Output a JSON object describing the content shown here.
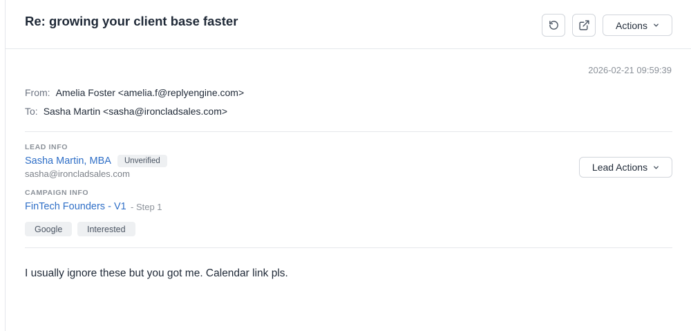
{
  "header": {
    "subject": "Re: growing your client base faster",
    "actions_label": "Actions"
  },
  "message": {
    "timestamp": "2026-02-21 09:59:39",
    "from_label": "From:",
    "from_value": "Amelia Foster <amelia.f@replyengine.com>",
    "to_label": "To:",
    "to_value": "Sasha Martin <sasha@ironcladsales.com>",
    "body": "I usually ignore these but you got me. Calendar link pls."
  },
  "lead": {
    "section_label": "LEAD INFO",
    "name": "Sasha Martin, MBA",
    "status_badge": "Unverified",
    "email": "sasha@ironcladsales.com",
    "actions_label": "Lead Actions"
  },
  "campaign": {
    "section_label": "CAMPAIGN INFO",
    "name": "FinTech Founders - V1",
    "step": "- Step 1",
    "tags": [
      "Google",
      "Interested"
    ]
  },
  "icons": {
    "undo": "undo-icon",
    "open_external": "external-link-icon",
    "chevron": "chevron-down-icon"
  },
  "colors": {
    "link": "#2f6fc7",
    "muted": "#8b9199",
    "badge_bg": "#eef0f2"
  }
}
